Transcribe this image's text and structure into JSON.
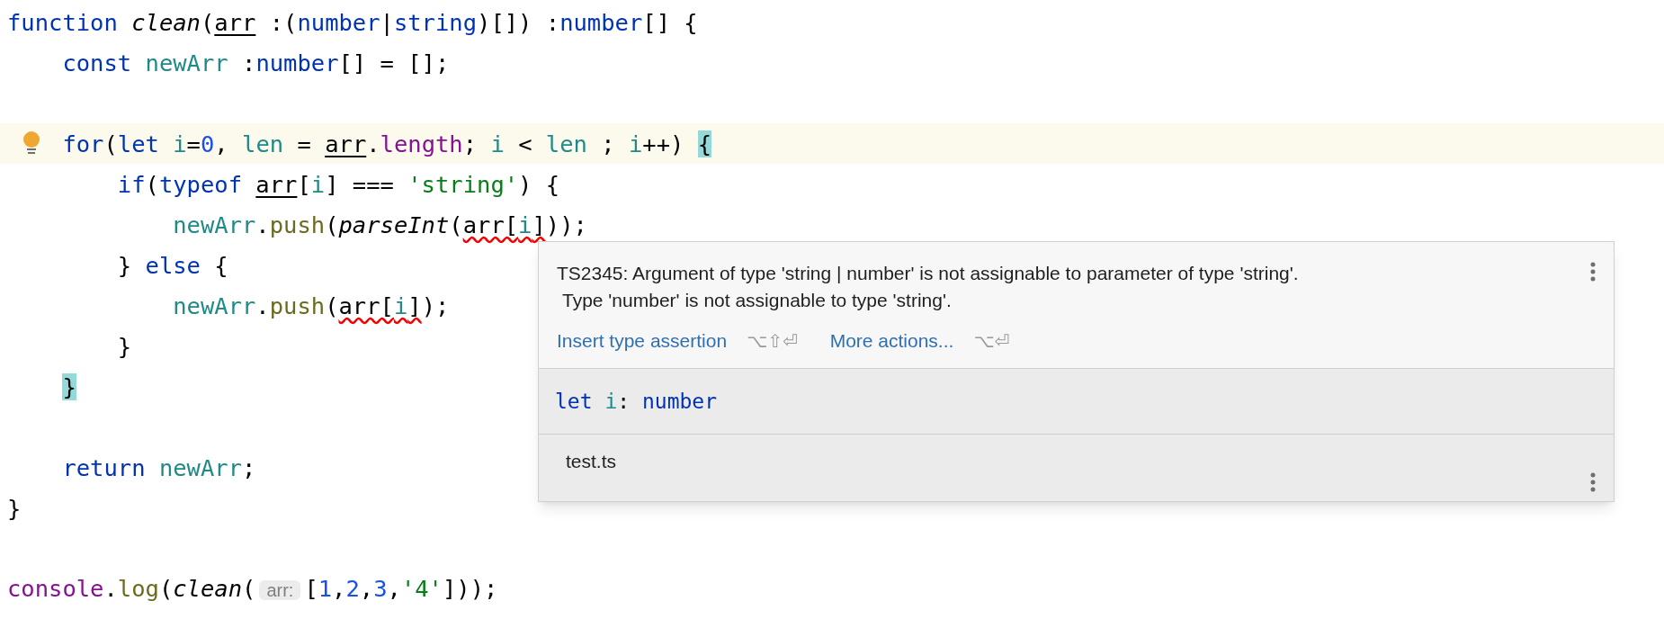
{
  "editor": {
    "lines": [
      {
        "current": false,
        "bulb": false,
        "tokens": [
          {
            "t": "function ",
            "kind": "kw"
          },
          {
            "t": "clean",
            "kind": "fn"
          },
          {
            "t": "(",
            "kind": "plain"
          },
          {
            "t": "arr",
            "kind": "param"
          },
          {
            "t": " :(",
            "kind": "plain"
          },
          {
            "t": "number",
            "kind": "type"
          },
          {
            "t": "|",
            "kind": "plain"
          },
          {
            "t": "string",
            "kind": "type"
          },
          {
            "t": ")[]) :",
            "kind": "plain"
          },
          {
            "t": "number",
            "kind": "type"
          },
          {
            "t": "[] {",
            "kind": "plain"
          }
        ]
      },
      {
        "current": false,
        "bulb": false,
        "tokens": [
          {
            "t": "    const ",
            "kind": "kw"
          },
          {
            "t": "newArr",
            "kind": "var"
          },
          {
            "t": " :",
            "kind": "plain"
          },
          {
            "t": "number",
            "kind": "type"
          },
          {
            "t": "[] = [];",
            "kind": "plain"
          }
        ]
      },
      {
        "current": false,
        "bulb": false
      },
      {
        "current": true,
        "bulb": true,
        "tokens": [
          {
            "t": "    for",
            "kind": "kw"
          },
          {
            "t": "(",
            "kind": "plain"
          },
          {
            "t": "let ",
            "kind": "kw"
          },
          {
            "t": "i",
            "kind": "var"
          },
          {
            "t": "=",
            "kind": "plain"
          },
          {
            "t": "0",
            "kind": "num"
          },
          {
            "t": ", ",
            "kind": "plain"
          },
          {
            "t": "len",
            "kind": "var"
          },
          {
            "t": " = ",
            "kind": "plain"
          },
          {
            "t": "arr",
            "kind": "param"
          },
          {
            "t": ".",
            "kind": "plain"
          },
          {
            "t": "length",
            "kind": "prop"
          },
          {
            "t": "; ",
            "kind": "plain"
          },
          {
            "t": "i",
            "kind": "var"
          },
          {
            "t": " < ",
            "kind": "plain"
          },
          {
            "t": "len",
            "kind": "var"
          },
          {
            "t": " ; ",
            "kind": "plain"
          },
          {
            "t": "i",
            "kind": "var"
          },
          {
            "t": "++) ",
            "kind": "plain"
          },
          {
            "t": "{",
            "kind": "brace"
          }
        ]
      },
      {
        "current": false,
        "bulb": false,
        "tokens": [
          {
            "t": "        if",
            "kind": "kw"
          },
          {
            "t": "(",
            "kind": "plain"
          },
          {
            "t": "typeof ",
            "kind": "kw"
          },
          {
            "t": "arr",
            "kind": "param"
          },
          {
            "t": "[",
            "kind": "plain"
          },
          {
            "t": "i",
            "kind": "var"
          },
          {
            "t": "] === ",
            "kind": "plain"
          },
          {
            "t": "'string'",
            "kind": "str"
          },
          {
            "t": ") {",
            "kind": "plain"
          }
        ]
      },
      {
        "current": false,
        "bulb": false,
        "tokens": [
          {
            "t": "            newArr",
            "kind": "var"
          },
          {
            "t": ".",
            "kind": "plain"
          },
          {
            "t": "push",
            "kind": "method"
          },
          {
            "t": "(",
            "kind": "plain"
          },
          {
            "t": "parseInt",
            "kind": "fn"
          },
          {
            "t": "(",
            "kind": "plain"
          },
          {
            "t": "arr[",
            "kind": "error"
          },
          {
            "t": "i",
            "kind": "errvar"
          },
          {
            "t": "]",
            "kind": "error"
          },
          {
            "t": "));",
            "kind": "plain"
          }
        ]
      },
      {
        "current": false,
        "bulb": false,
        "tokens": [
          {
            "t": "        } ",
            "kind": "plain"
          },
          {
            "t": "else",
            "kind": "kw"
          },
          {
            "t": " {",
            "kind": "plain"
          }
        ]
      },
      {
        "current": false,
        "bulb": false,
        "tokens": [
          {
            "t": "            newArr",
            "kind": "var"
          },
          {
            "t": ".",
            "kind": "plain"
          },
          {
            "t": "push",
            "kind": "method"
          },
          {
            "t": "(",
            "kind": "plain"
          },
          {
            "t": "arr[",
            "kind": "error"
          },
          {
            "t": "i",
            "kind": "errvar"
          },
          {
            "t": "]",
            "kind": "error"
          },
          {
            "t": ");",
            "kind": "plain"
          }
        ]
      },
      {
        "current": false,
        "bulb": false,
        "tokens": [
          {
            "t": "        }",
            "kind": "plain"
          }
        ]
      },
      {
        "current": false,
        "bulb": false,
        "tokens": [
          {
            "t": "    }",
            "kind": "brace"
          }
        ]
      },
      {
        "current": false,
        "bulb": false
      },
      {
        "current": false,
        "bulb": false,
        "tokens": [
          {
            "t": "    return ",
            "kind": "kw"
          },
          {
            "t": "newArr",
            "kind": "var"
          },
          {
            "t": ";",
            "kind": "plain"
          }
        ]
      },
      {
        "current": false,
        "bulb": false,
        "tokens": [
          {
            "t": "}",
            "kind": "plain"
          }
        ]
      },
      {
        "current": false,
        "bulb": false
      },
      {
        "current": false,
        "bulb": false,
        "tokens": [
          {
            "t": "console",
            "kind": "prop"
          },
          {
            "t": ".",
            "kind": "plain"
          },
          {
            "t": "log",
            "kind": "method"
          },
          {
            "t": "(",
            "kind": "plain"
          },
          {
            "t": "clean",
            "kind": "fn"
          },
          {
            "t": "(",
            "kind": "plain"
          },
          {
            "t": "arr:",
            "kind": "hint"
          },
          {
            "t": "[",
            "kind": "plain"
          },
          {
            "t": "1",
            "kind": "num"
          },
          {
            "t": ",",
            "kind": "plain"
          },
          {
            "t": "2",
            "kind": "num"
          },
          {
            "t": ",",
            "kind": "plain"
          },
          {
            "t": "3",
            "kind": "num"
          },
          {
            "t": ",",
            "kind": "plain"
          },
          {
            "t": "'4'",
            "kind": "str"
          },
          {
            "t": "]));",
            "kind": "plain"
          }
        ]
      }
    ]
  },
  "popup": {
    "message": [
      "TS2345: Argument of type 'string | number' is not assignable to parameter of type 'string'.",
      "Type 'number' is not assignable to type 'string'."
    ],
    "actions": [
      {
        "label": "Insert type assertion",
        "shortcut": "⌥⇧⏎"
      },
      {
        "label": "More actions...",
        "shortcut": "⌥⏎"
      }
    ],
    "declaration": [
      {
        "t": "let ",
        "kind": "kw"
      },
      {
        "t": "i",
        "kind": "var"
      },
      {
        "t": ": ",
        "kind": "plain"
      },
      {
        "t": "number",
        "kind": "type"
      }
    ],
    "file": "test.ts"
  }
}
